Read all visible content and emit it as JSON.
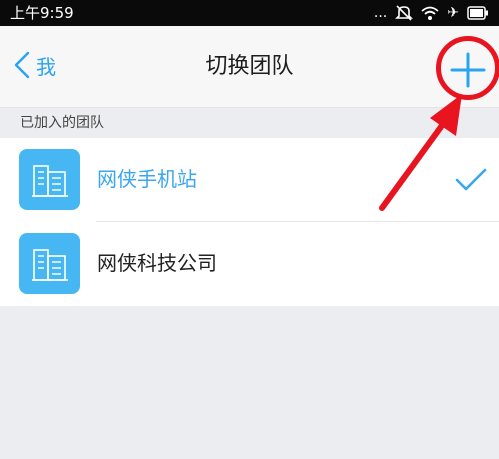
{
  "status_bar": {
    "time": "上午9:59",
    "icons": [
      "more-dots-icon",
      "muted-icon",
      "wifi-icon",
      "airplane-icon",
      "battery-icon"
    ],
    "dots": "...",
    "airplane": "✈"
  },
  "nav_bar": {
    "back_label": "我",
    "title": "切换团队",
    "add_icon": "plus-icon"
  },
  "section": {
    "label": "已加入的团队"
  },
  "teams": [
    {
      "name": "网侠手机站",
      "selected": true,
      "icon": "building-icon"
    },
    {
      "name": "网侠科技公司",
      "selected": false,
      "icon": "building-icon"
    }
  ],
  "colors": {
    "accent": "#2aa3f0",
    "avatar": "#46b7f2",
    "annotation": "#e8141f"
  }
}
